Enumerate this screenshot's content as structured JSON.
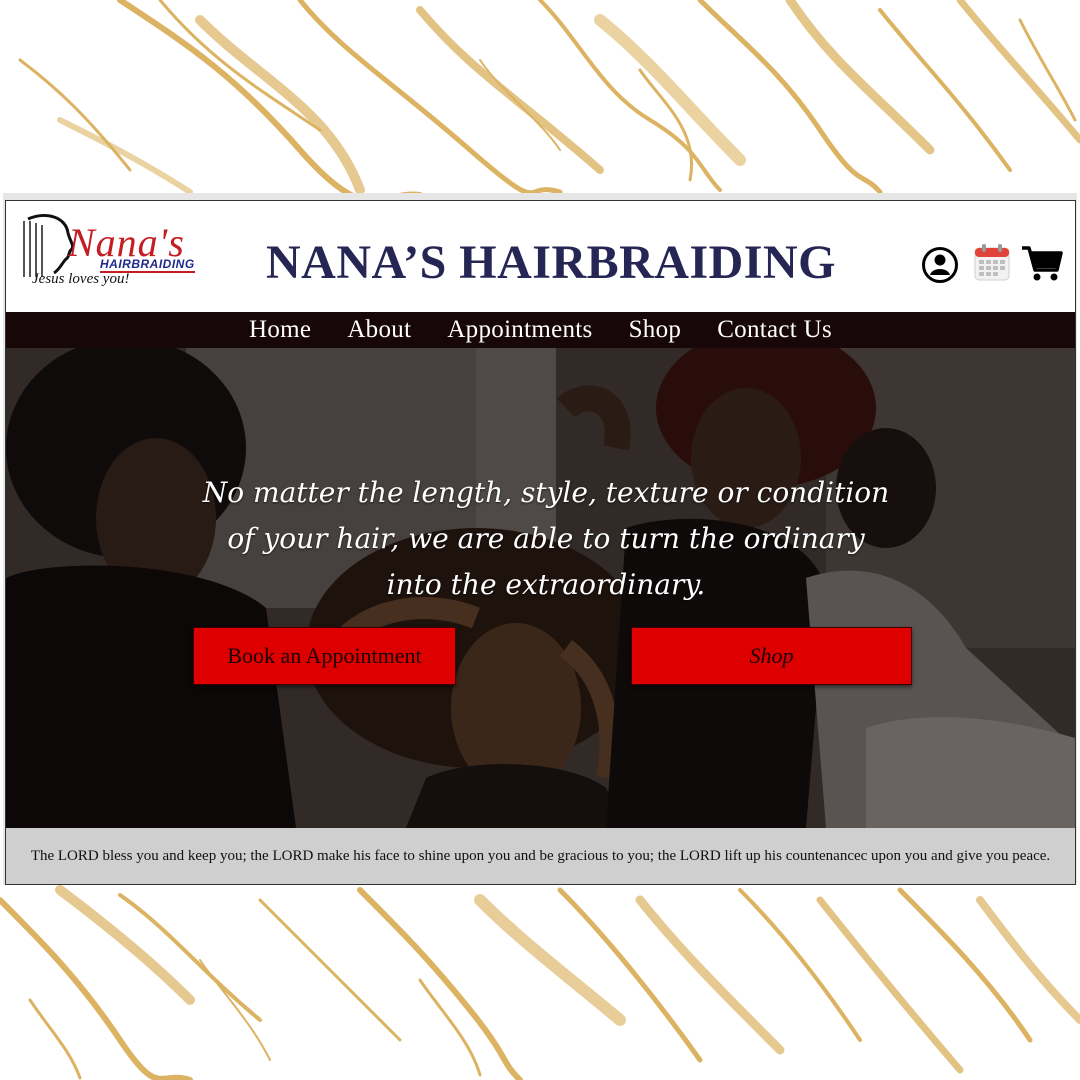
{
  "brand": {
    "logo_name": "Nana's",
    "logo_sub": "HAIRBRAIDING",
    "logo_tagline": "Jesus loves you!",
    "site_title": "NANA’S HAIRBRAIDING"
  },
  "header_icons": [
    "user-icon",
    "calendar-icon",
    "cart-icon"
  ],
  "nav": {
    "items": [
      {
        "label": "Home"
      },
      {
        "label": "About"
      },
      {
        "label": "Appointments"
      },
      {
        "label": "Shop"
      },
      {
        "label": "Contact Us"
      }
    ]
  },
  "hero": {
    "text": "No matter the length, style, texture or condition of your hair, we are able to turn the ordinary into the extraordinary.",
    "book_label": "Book an Appointment",
    "shop_label": "Shop"
  },
  "footer": {
    "verse": "The LORD bless you and keep you; the LORD make his face to shine upon you and be gracious to you; the LORD lift up his countenancec upon you and give you peace."
  },
  "colors": {
    "title": "#262654",
    "nav_bg": "#180708",
    "button_red": "#de0000",
    "footer_bg": "#cfcfcf",
    "gold": "#d4a64a"
  }
}
